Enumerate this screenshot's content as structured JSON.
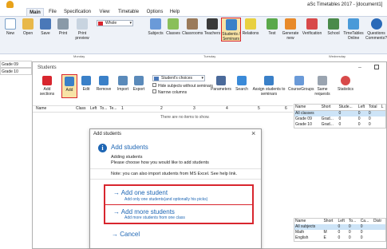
{
  "app_title": "aSc Timetables 2017 - [document1]",
  "ribbon_tabs": [
    "Main",
    "File",
    "Specification",
    "View",
    "Timetable",
    "Options",
    "Help"
  ],
  "view_select": "Whole",
  "ribbon_buttons": [
    "New",
    "Open",
    "Save",
    "Print",
    "Print preview",
    "Subjects",
    "Classes",
    "Classrooms",
    "Teachers",
    "Students / Seminars",
    "Relations",
    "Test",
    "Generate new",
    "Verification",
    "School",
    "TimeTables Online",
    "Questions Comments?"
  ],
  "grid_days": [
    "Monday",
    "Tuesday",
    "Wednesday"
  ],
  "grid_rows": [
    "Grade 09",
    "Grade 10"
  ],
  "students_window": {
    "title": "Students",
    "toolbar": [
      "Add sections",
      "Add",
      "Edit",
      "Remove",
      "Import",
      "Export",
      "Parameters",
      "Search",
      "Assign students to seminars",
      "CourseGroups",
      "Same requests",
      "Statistics"
    ],
    "dropdown": "Student's choices",
    "checkboxes": [
      "Hide subjects without seminars",
      "Narrow columns"
    ],
    "columns": [
      "Name",
      "Class",
      "Left",
      "To...",
      "Te...",
      "1",
      "2",
      "3",
      "4",
      "5",
      "6"
    ],
    "empty_text": "There are no items to show.",
    "classes_table": {
      "headers": [
        "Name",
        "Short",
        "Stude...",
        "Left",
        "Total",
        "L"
      ],
      "rows": [
        [
          "All classes",
          "",
          "0",
          "0",
          "0",
          ""
        ],
        [
          "Grade 09",
          "Grad...",
          "0",
          "0",
          "0",
          ""
        ],
        [
          "Grade 10",
          "Grad...",
          "0",
          "0",
          "0",
          ""
        ]
      ]
    },
    "subjects_table": {
      "headers": [
        "Name",
        "Short",
        "Left",
        "To...",
        "Ca...",
        "Distr"
      ],
      "rows": [
        [
          "All subjects",
          "",
          "0",
          "0",
          "0",
          ""
        ],
        [
          "Math",
          "M",
          "0",
          "0",
          "0",
          ""
        ],
        [
          "English",
          "E",
          "0",
          "0",
          "0",
          ""
        ]
      ]
    }
  },
  "dialog": {
    "title": "Add students",
    "close": "×",
    "info_icon": "i",
    "heading": "Add students",
    "desc1": "Adding students",
    "desc2": "Please choose how you would like to add students",
    "note": "Note: you can also import students from MS Excel. See help link.",
    "opt1_title": "→  Add one student",
    "opt1_sub": "Add only one students(and optionally his picks)",
    "opt2_title": "→  Add more students",
    "opt2_sub": "Add more students from one class",
    "cancel": "→  Cancel"
  },
  "colors": {
    "accent": "#1e66b4",
    "highlight": "#d8262e"
  }
}
